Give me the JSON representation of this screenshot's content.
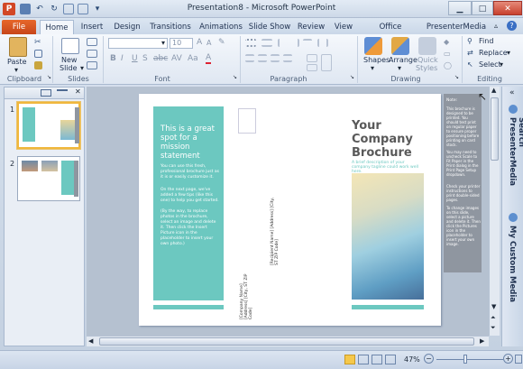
{
  "window": {
    "title": "Presentation8 - Microsoft PowerPoint"
  },
  "tabs": [
    "File",
    "Home",
    "Insert",
    "Design",
    "Transitions",
    "Animations",
    "Slide Show",
    "Review",
    "View",
    "Office Timeline+",
    "PresenterMedia"
  ],
  "ribbon": {
    "paste": "Paste",
    "new_slide_1": "New",
    "new_slide_2": "Slide",
    "font_size": "10",
    "shapes": "Shapes",
    "arrange": "Arrange",
    "quick_1": "Quick",
    "quick_2": "Styles",
    "find": "Find",
    "replace": "Replace",
    "select": "Select",
    "groups": {
      "clipboard": "Clipboard",
      "slides": "Slides",
      "font": "Font",
      "paragraph": "Paragraph",
      "drawing": "Drawing",
      "editing": "Editing"
    }
  },
  "pane": {
    "slide1_num": "1",
    "slide2_num": "2"
  },
  "slide": {
    "panel_heading": "This is a great spot for a mission statement",
    "panel_body1": "You can use this fresh, professional brochure just as it is or easily customize it.",
    "panel_body2": "On the next page, we've added a few tips (like this one) to help you get started.",
    "panel_body3": "(By the way, to replace photos in the brochure, select an image and delete it. Then click the Insert Picture icon in the placeholder to insert your own photo.)",
    "address_mid": "[Recipient Name] [Address] [City, ST ZIP Code]",
    "address_left": "[Company Name] [Address] [City, ST ZIP Code]",
    "cover_title": "Your Company Brochure",
    "cover_tagline": "A brief description of your company tagline could work well here.",
    "note_title": "Note:",
    "note_p1": "This brochure is designed to be printed. You should test print on regular paper to ensure proper positioning before printing on card stock.",
    "note_p2": "You may need to uncheck Scale to Fit Paper in the Print dialog in the Print Page Setup dropdown.",
    "note_p3": "Check your printer instructions to print double-sided pages.",
    "note_p4": "To change images on this slide, select a picture and delete it. Then click the Pictures icon in the placeholder to insert your own image."
  },
  "side_panel": {
    "search": "Search PresenterMedia",
    "custom": "My Custom Media"
  },
  "status": {
    "zoom": "47%"
  },
  "colors": {
    "accent": "#6cc8c0",
    "file_tab": "#d9541e"
  }
}
